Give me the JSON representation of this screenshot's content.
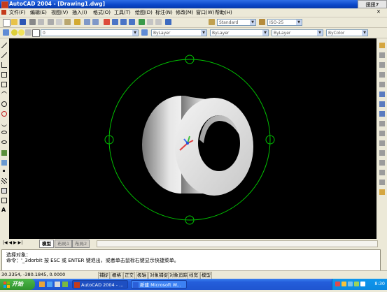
{
  "window": {
    "title": "AutoCAD 2004 - [Drawing1.dwg]",
    "watermark_logo": "扭扭7"
  },
  "menu": [
    "文件(F)",
    "编辑(E)",
    "视图(V)",
    "插入(I)",
    "格式(O)",
    "工具(T)",
    "绘图(D)",
    "标注(N)",
    "修改(M)",
    "窗口(W)",
    "帮助(H)"
  ],
  "toolbars": {
    "text_style": "Standard",
    "dim_style": "ISO-25",
    "layer_value": "0",
    "color_value": "ByLayer",
    "linetype_value": "ByLayer",
    "lineweight_value": "ByLayer",
    "plotstyle_value": "ByColor"
  },
  "tabs": {
    "model": "模型",
    "layout1": "布局1",
    "layout2": "布局2"
  },
  "command": {
    "line1": "选择对象：",
    "line2": "命令：'_3dorbit 按 ESC 或 ENTER 键退出，或者单击鼠标右键显示快捷菜单。"
  },
  "status": {
    "coords": "30.3354,  -380.1845, 0.0000",
    "modes": [
      "捕捉",
      "栅格",
      "正交",
      "极轴",
      "对象捕捉",
      "对象追踪",
      "线宽",
      "模型"
    ]
  },
  "taskbar": {
    "start": "开始",
    "tasks": [
      "AutoCAD 2004 - ...",
      "新建 Microsoft W..."
    ],
    "clock": "8:30"
  },
  "colors": {
    "canvas": "#000000",
    "orbit_circle": "#00c000",
    "xp_blue": "#245edb",
    "start_green": "#3a9d37"
  },
  "icons": [
    "save-icon",
    "print-icon",
    "zoom-icon",
    "pan-icon",
    "line-icon",
    "circle-icon",
    "erase-icon",
    "move-icon",
    "ucs-icon"
  ]
}
